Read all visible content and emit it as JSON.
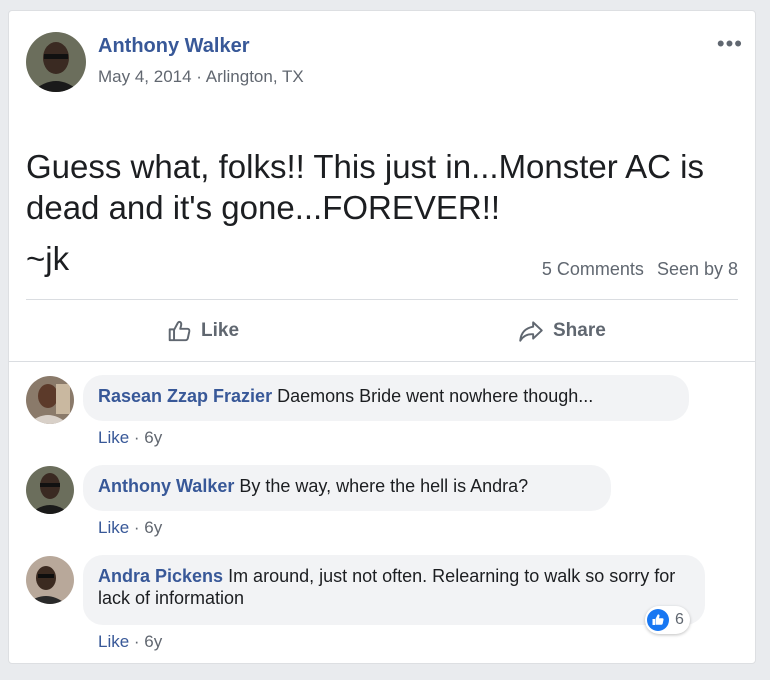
{
  "post": {
    "author": "Anthony Walker",
    "date": "May 4, 2014",
    "separator": " · ",
    "location": "Arlington, TX",
    "more_label": "•••",
    "text_line": "Guess what, folks!! This just in...Monster AC is dead and it's gone...FOREVER!!",
    "text_tail": "~jk",
    "comments_count": "5 Comments",
    "seen_by": "Seen by 8",
    "like_label": "Like",
    "share_label": "Share"
  },
  "comments": [
    {
      "name": "Rasean Zzap Frazier",
      "text": "Daemons Bride went nowhere though...",
      "like": "Like",
      "sep": " · ",
      "time": "6y"
    },
    {
      "name": "Anthony Walker",
      "text": "By the way, where the hell is Andra?",
      "like": "Like",
      "sep": " · ",
      "time": "6y"
    },
    {
      "name": "Andra Pickens",
      "text": "Im around, just not often. Relearning to walk so sorry for lack of information",
      "like": "Like",
      "sep": " · ",
      "time": "6y",
      "reactions": "6"
    }
  ],
  "colors": {
    "link": "#385898",
    "like_reaction": "#1877f2"
  }
}
